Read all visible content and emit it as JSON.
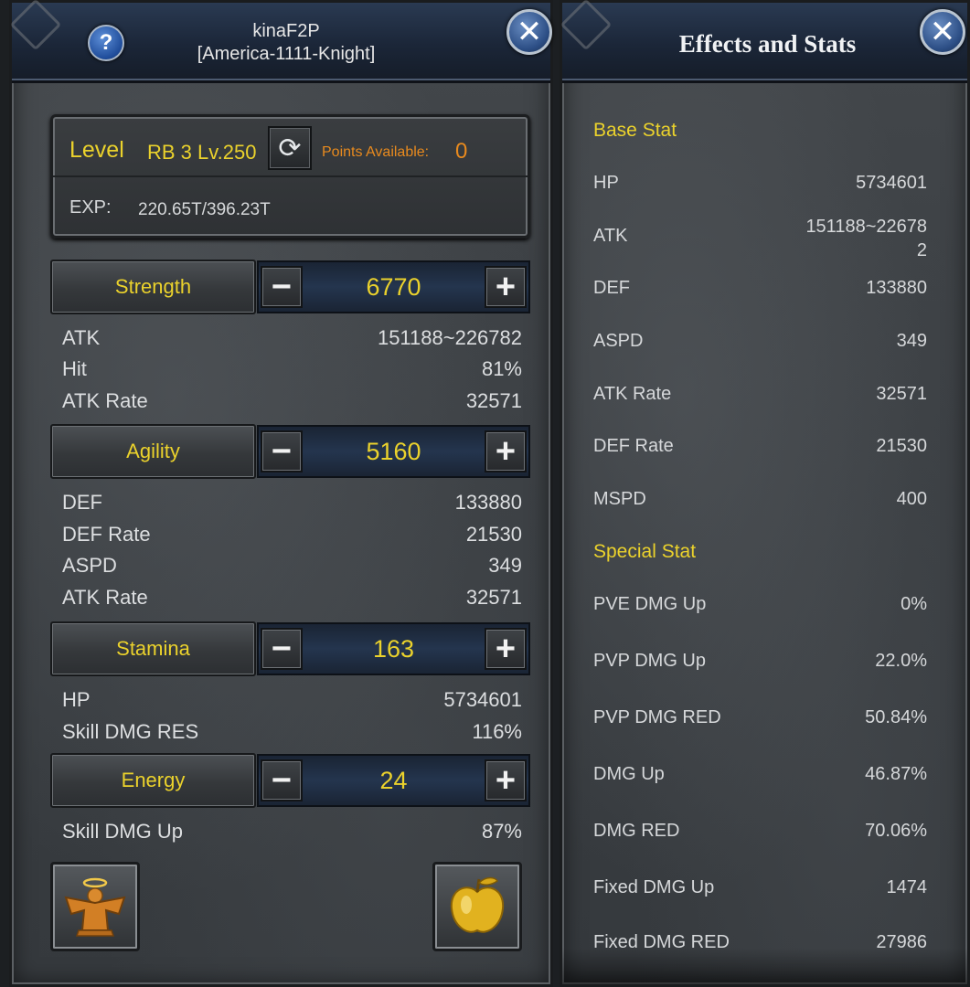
{
  "character": {
    "name": "kinaF2P",
    "server": "[America-1111-Knight]",
    "help_icon": "question-icon",
    "close_icon": "close-icon"
  },
  "level": {
    "label": "Level",
    "value": "RB 3 Lv.250",
    "reset_icon": "refresh-icon",
    "points_label": "Points Available:",
    "points_value": "0",
    "exp_label": "EXP:",
    "exp_value": "220.65T/396.23T"
  },
  "attributes": [
    {
      "name": "Strength",
      "value": "6770",
      "minus_icon": "minus-icon",
      "plus_icon": "plus-icon",
      "effects": [
        {
          "label": "ATK",
          "value": "151188~226782"
        },
        {
          "label": "Hit",
          "value": "81%"
        },
        {
          "label": "ATK Rate",
          "value": "32571"
        }
      ]
    },
    {
      "name": "Agility",
      "value": "5160",
      "minus_icon": "minus-icon",
      "plus_icon": "plus-icon",
      "effects": [
        {
          "label": "DEF",
          "value": "133880"
        },
        {
          "label": "DEF Rate",
          "value": "21530"
        },
        {
          "label": "ASPD",
          "value": "349"
        },
        {
          "label": "ATK Rate",
          "value": "32571"
        }
      ]
    },
    {
      "name": "Stamina",
      "value": "163",
      "minus_icon": "minus-icon",
      "plus_icon": "plus-icon",
      "effects": [
        {
          "label": "HP",
          "value": "5734601"
        },
        {
          "label": "Skill DMG RES",
          "value": "116%"
        }
      ]
    },
    {
      "name": "Energy",
      "value": "24",
      "minus_icon": "minus-icon",
      "plus_icon": "plus-icon",
      "effects": [
        {
          "label": "Skill DMG Up",
          "value": "87%"
        }
      ]
    }
  ],
  "item_slots": [
    {
      "icon": "angel-statue-icon"
    },
    {
      "icon": "golden-apple-icon"
    }
  ],
  "effects_panel": {
    "title": "Effects and Stats",
    "close_icon": "close-icon",
    "base_title": "Base Stat",
    "base_stats": [
      {
        "label": "HP",
        "value": "5734601"
      },
      {
        "label": "ATK",
        "value": "151188~226782"
      },
      {
        "label": "DEF",
        "value": "133880"
      },
      {
        "label": "ASPD",
        "value": "349"
      },
      {
        "label": "ATK Rate",
        "value": "32571"
      },
      {
        "label": "DEF Rate",
        "value": "21530"
      },
      {
        "label": "MSPD",
        "value": "400"
      }
    ],
    "special_title": "Special Stat",
    "special_stats": [
      {
        "label": "PVE DMG Up",
        "value": "0%"
      },
      {
        "label": "PVP DMG Up",
        "value": "22.0%"
      },
      {
        "label": "PVP DMG RED",
        "value": "50.84%"
      },
      {
        "label": "DMG Up",
        "value": "46.87%"
      },
      {
        "label": "DMG RED",
        "value": "70.06%"
      },
      {
        "label": "Fixed DMG Up",
        "value": "1474"
      },
      {
        "label": "Fixed DMG RED",
        "value": "27986"
      }
    ]
  },
  "colors": {
    "accent_yellow": "#ebd22c",
    "points_orange": "#e88a1e",
    "header_blue": "#1b2638"
  }
}
